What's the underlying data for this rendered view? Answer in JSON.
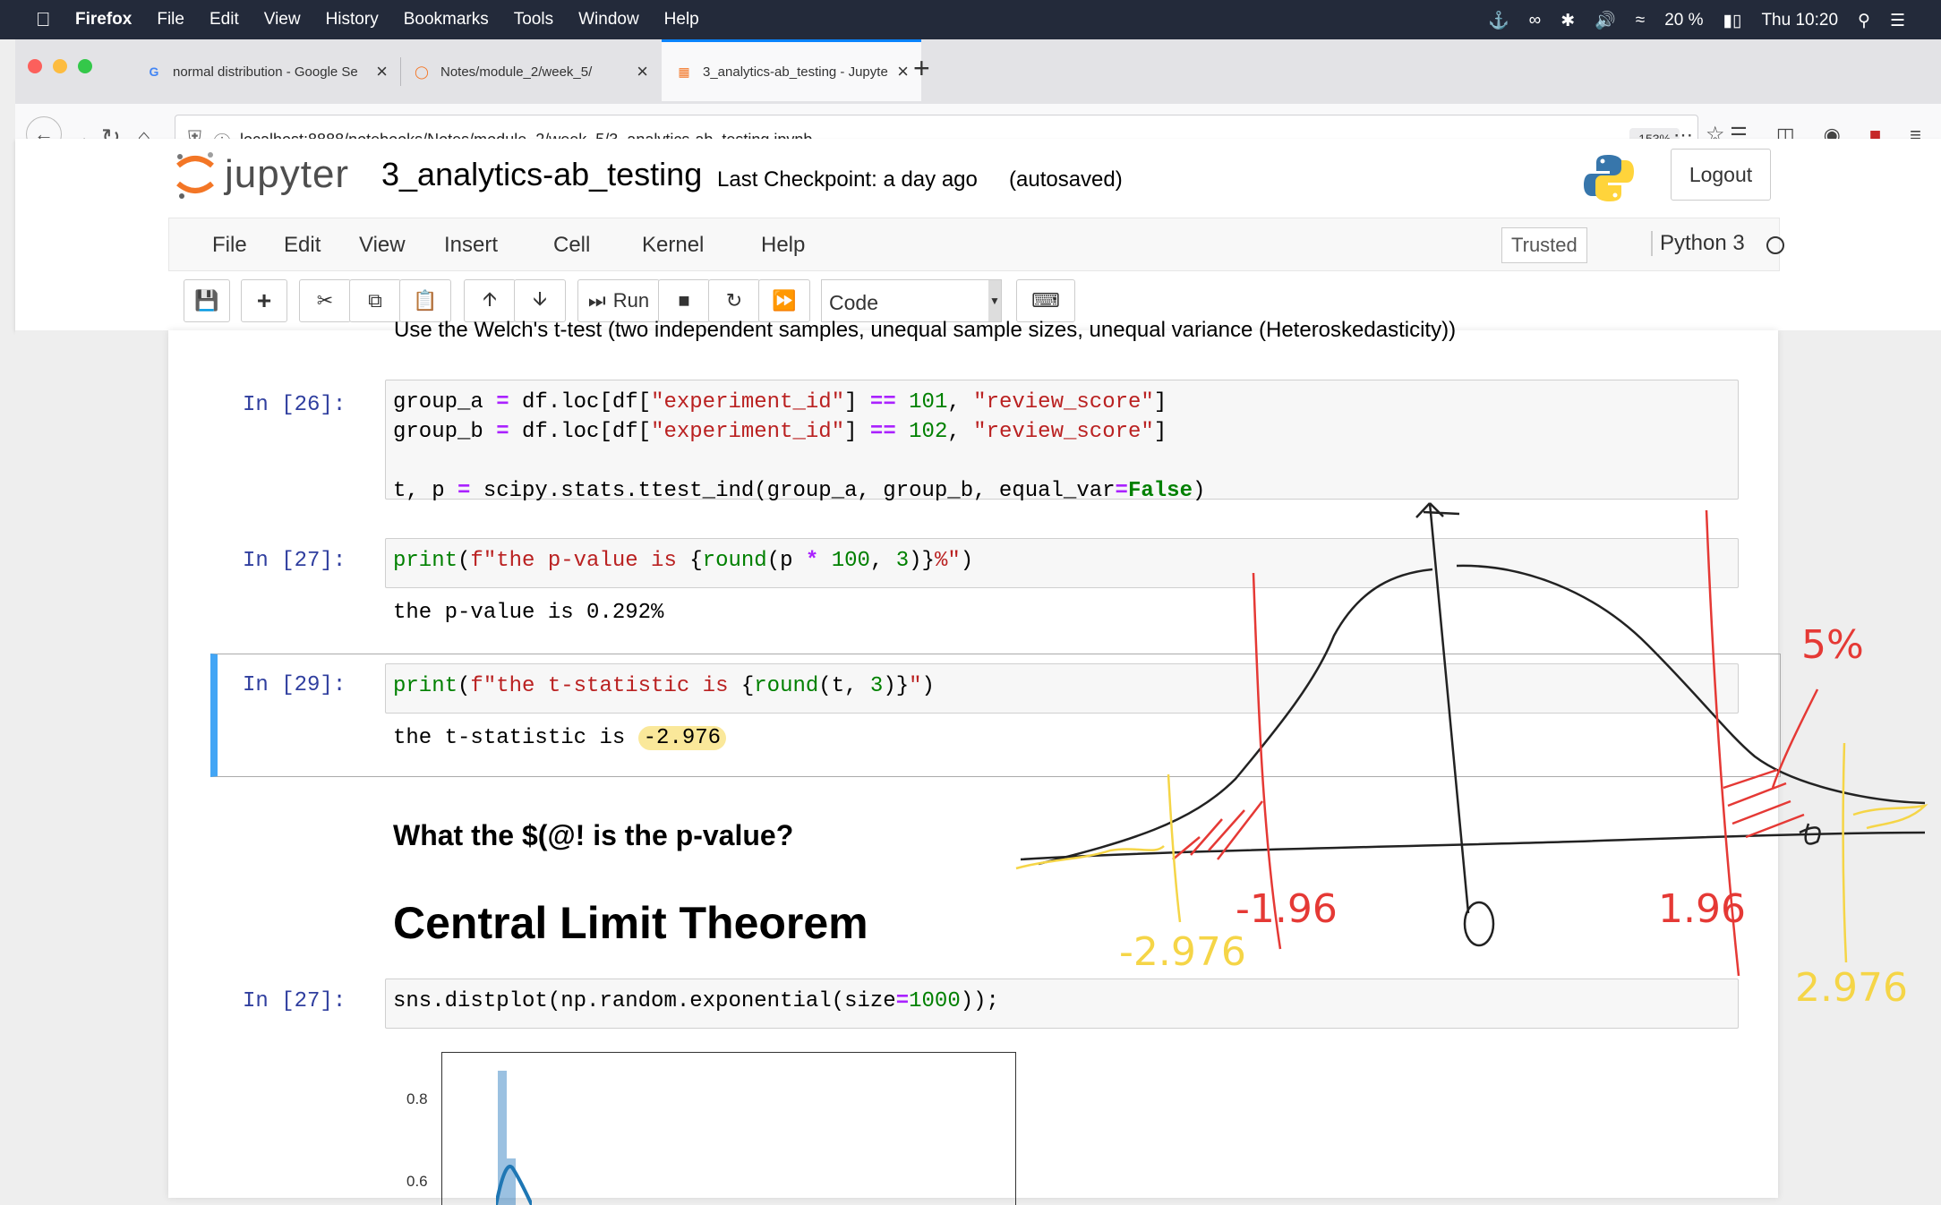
{
  "mac_menubar": {
    "app": "Firefox",
    "menus": [
      "File",
      "Edit",
      "View",
      "History",
      "Bookmarks",
      "Tools",
      "Window",
      "Help"
    ],
    "battery": "20 %",
    "clock": "Thu 10:20"
  },
  "browser": {
    "tabs": [
      {
        "title": "normal distribution - Google Se",
        "icon": "google-icon"
      },
      {
        "title": "Notes/module_2/week_5/",
        "icon": "jupyter-spinner-icon"
      },
      {
        "title": "3_analytics-ab_testing - Jupyte",
        "icon": "jupyter-notebook-icon",
        "active": true
      }
    ],
    "url_host": "localhost",
    "url_path": ":8888/notebooks/Notes/module_2/week_5/3_analytics-ab_testing.ipynb",
    "zoom": "153%"
  },
  "jupyter": {
    "logo_text": "jupyter",
    "notebook_name": "3_analytics-ab_testing",
    "checkpoint": "Last Checkpoint: a day ago",
    "autosave": "(autosaved)",
    "logout": "Logout",
    "menu": [
      "File",
      "Edit",
      "View",
      "Insert",
      "Cell",
      "Kernel",
      "Help"
    ],
    "trusted": "Trusted",
    "kernel": "Python 3",
    "run_label": "Run",
    "cell_type": "Code"
  },
  "notebook": {
    "partial_text": "Use the Welch's t-test (two independent samples, unequal sample sizes, unequal variance (Heteroskedasticity))",
    "cells": [
      {
        "prompt": "In [26]:"
      },
      {
        "prompt": "In [27]:",
        "output": "the p-value is 0.292%"
      },
      {
        "prompt": "In [29]:",
        "output_prefix": "the t-statistic is ",
        "output_value": "-2.976"
      },
      {
        "prompt": "In [27]:"
      }
    ],
    "heading_p_value": "What the $(@! is the p-value?",
    "heading_clt": "Central Limit Theorem",
    "plot_yticks": [
      "0.8",
      "0.6"
    ]
  },
  "annotations": {
    "minus_196": "-1.96",
    "plus_196": "1.96",
    "zero": "0",
    "minus_2976": "-2.976",
    "plus_2976": "2.976",
    "five_percent": "5%",
    "red": "#e53935",
    "yellow": "#f5d547",
    "black": "#222222"
  }
}
